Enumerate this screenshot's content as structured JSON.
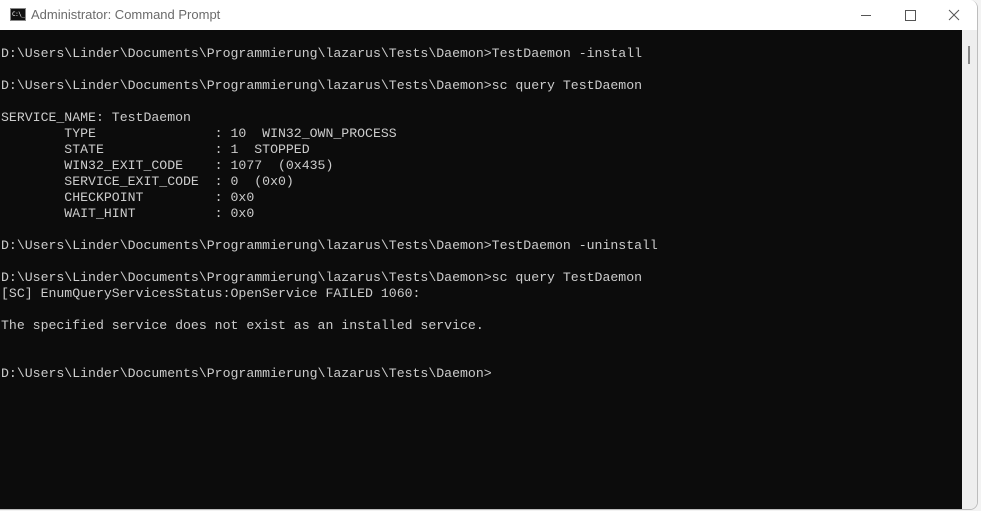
{
  "window": {
    "title": "Administrator: Command Prompt",
    "app_icon_text": "C:\\_",
    "controls": {
      "minimize": "minimize",
      "maximize": "maximize",
      "close": "close"
    }
  },
  "console": {
    "lines": [
      "D:\\Users\\Linder\\Documents\\Programmierung\\lazarus\\Tests\\Daemon>TestDaemon -install",
      "",
      "D:\\Users\\Linder\\Documents\\Programmierung\\lazarus\\Tests\\Daemon>sc query TestDaemon",
      "",
      "SERVICE_NAME: TestDaemon",
      "        TYPE               : 10  WIN32_OWN_PROCESS",
      "        STATE              : 1  STOPPED",
      "        WIN32_EXIT_CODE    : 1077  (0x435)",
      "        SERVICE_EXIT_CODE  : 0  (0x0)",
      "        CHECKPOINT         : 0x0",
      "        WAIT_HINT          : 0x0",
      "",
      "D:\\Users\\Linder\\Documents\\Programmierung\\lazarus\\Tests\\Daemon>TestDaemon -uninstall",
      "",
      "D:\\Users\\Linder\\Documents\\Programmierung\\lazarus\\Tests\\Daemon>sc query TestDaemon",
      "[SC] EnumQueryServicesStatus:OpenService FAILED 1060:",
      "",
      "The specified service does not exist as an installed service.",
      "",
      "",
      "D:\\Users\\Linder\\Documents\\Programmierung\\lazarus\\Tests\\Daemon>"
    ]
  }
}
